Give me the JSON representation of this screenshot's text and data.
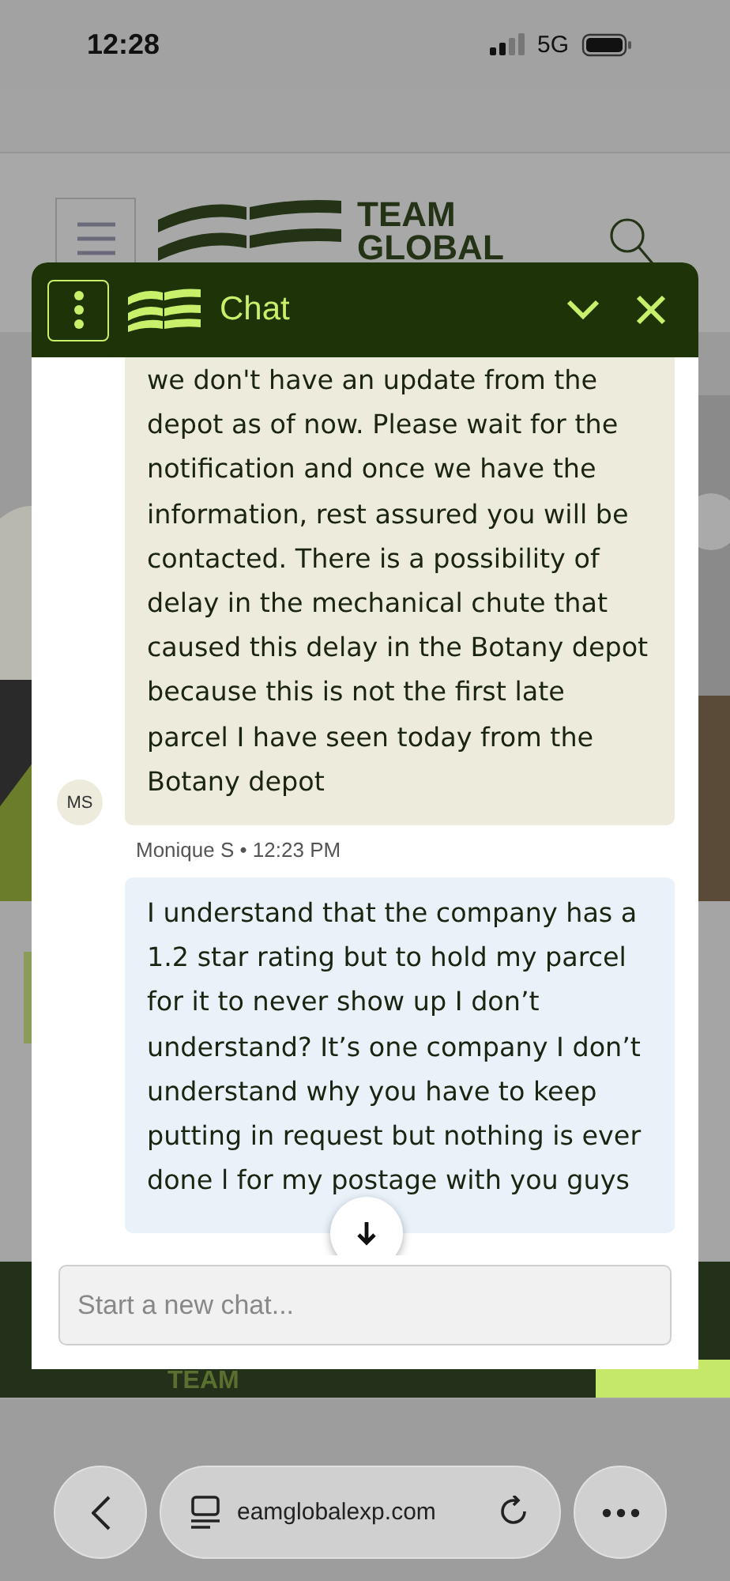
{
  "status_bar": {
    "time": "12:28",
    "network": "5G"
  },
  "site_header": {
    "logo_lines": [
      "TEAM",
      "GLOBAL"
    ]
  },
  "chat": {
    "title": "Chat",
    "messages": [
      {
        "kind": "agent",
        "avatar": "MS",
        "text": "we don't have an update from the depot as of now. Please wait for the notification and once we have the information, rest assured you will be contacted. There is a possibility of delay in the mechanical chute that caused this delay in the Botany depot because this is not the first late parcel I have seen today from the Botany depot",
        "meta": "Monique S • 12:23 PM"
      },
      {
        "kind": "customer",
        "text": "I understand that the company has a 1.2 star rating but to hold my parcel for it to never show up I don’t understand? It’s one company I don’t understand why you have to keep putting in request but nothing is ever done l for my postage with you guys"
      }
    ],
    "input": {
      "placeholder": "Start a new chat..."
    }
  },
  "footer": {
    "logo_text": "TEAM"
  },
  "browser_bar": {
    "url": "eamglobalexp.com"
  }
}
